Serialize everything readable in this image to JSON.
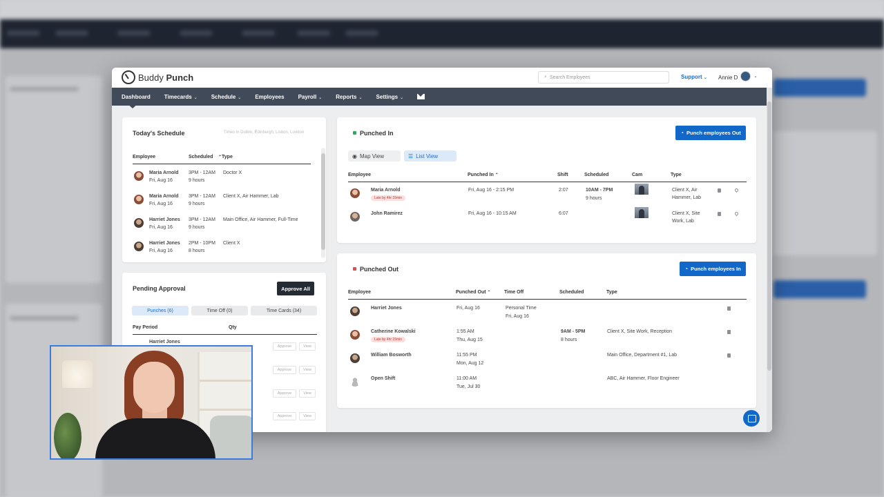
{
  "app": {
    "logo_prefix": "Buddy",
    "logo_suffix": "Punch",
    "search_placeholder": "Search Employees",
    "support": "Support",
    "user": "Annie D"
  },
  "nav": [
    "Dashboard",
    "Timecards",
    "Schedule",
    "Employees",
    "Payroll",
    "Reports",
    "Settings"
  ],
  "schedule": {
    "title": "Today's Schedule",
    "timezone": "Times in Dublin, Edinburgh, Lisbon, London",
    "columns": [
      "Employee",
      "Scheduled",
      "Type"
    ],
    "rows": [
      {
        "name": "Maria Arnold",
        "date": "Fri, Aug 16",
        "time": "3PM - 12AM",
        "hours": "9 hours",
        "type": "Doctor X"
      },
      {
        "name": "Maria Arnold",
        "date": "Fri, Aug 16",
        "time": "3PM - 12AM",
        "hours": "9 hours",
        "type": "Client X, Air Hammer, Lab"
      },
      {
        "name": "Harriet Jones",
        "date": "Fri, Aug 16",
        "time": "3PM - 12AM",
        "hours": "9 hours",
        "type": "Main Office, Air Hammer, Full-Time"
      },
      {
        "name": "Harriet Jones",
        "date": "Fri, Aug 16",
        "time": "2PM - 10PM",
        "hours": "8 hours",
        "type": "Client X"
      }
    ]
  },
  "pending": {
    "title": "Pending Approval",
    "approve_all": "Approve All",
    "tabs": [
      "Punches (6)",
      "Time Off (0)",
      "Time Cards (34)"
    ],
    "columns": [
      "Pay Period",
      "Qty"
    ],
    "first_name": "Harriet Jones",
    "approve": "Approve",
    "view": "View"
  },
  "punched_in": {
    "title": "Punched In",
    "button": "Punch employees Out",
    "map_view": "Map View",
    "list_view": "List View",
    "columns": [
      "Employee",
      "Punched In",
      "Shift",
      "Scheduled",
      "Cam",
      "Type"
    ],
    "rows": [
      {
        "name": "Maria Arnold",
        "badge": "Late by 4hr 15min",
        "punched": "Fri, Aug 16 - 2:15 PM",
        "shift": "2:07",
        "scheduled": "10AM - 7PM",
        "sched_hours": "9 hours",
        "type1": "Client X, Air",
        "type2": "Hammer, Lab"
      },
      {
        "name": "John Ramirez",
        "badge": "",
        "punched": "Fri, Aug 16 - 10:15 AM",
        "shift": "6:07",
        "scheduled": "",
        "sched_hours": "",
        "type1": "Client X, Site",
        "type2": "Work, Lab"
      }
    ]
  },
  "punched_out": {
    "title": "Punched Out",
    "button": "Punch employees In",
    "columns": [
      "Employee",
      "Punched Out",
      "Time Off",
      "Scheduled",
      "Type"
    ],
    "rows": [
      {
        "name": "Harriet Jones",
        "badge": "",
        "time": "Fri, Aug 16",
        "date": "",
        "timeoff": "Personal Time",
        "timeoff_date": "Fri, Aug 16",
        "scheduled": "",
        "sched_hours": "",
        "type": ""
      },
      {
        "name": "Catherine Kowalski",
        "badge": "Late by 4hr 15min",
        "time": "1:55 AM",
        "date": "Thu, Aug 15",
        "timeoff": "",
        "timeoff_date": "",
        "scheduled": "9AM - 5PM",
        "sched_hours": "8 hours",
        "type": "Client X, Site Work, Reception"
      },
      {
        "name": "William Bosworth",
        "badge": "",
        "time": "11:55 PM",
        "date": "Mon, Aug 12",
        "timeoff": "",
        "timeoff_date": "",
        "scheduled": "",
        "sched_hours": "",
        "type": "Main Office, Department #1, Lab"
      },
      {
        "name": "Open Shift",
        "badge": "",
        "time": "11:00 AM",
        "date": "Tue, Jul 30",
        "timeoff": "",
        "timeoff_date": "",
        "scheduled": "",
        "sched_hours": "",
        "type": "ABC, Air Hammer, Floor Engineer"
      }
    ]
  },
  "colors": {
    "accent": "#1268c9",
    "nav": "#404a59",
    "green": "#2ea85e",
    "red": "#e04b4b"
  },
  "icons": [
    "clock-logo-icon",
    "search-icon",
    "chevron-down-icon",
    "mail-icon",
    "globe-icon",
    "list-icon",
    "note-icon",
    "location-pin-icon",
    "clock-icon",
    "chat-icon"
  ]
}
